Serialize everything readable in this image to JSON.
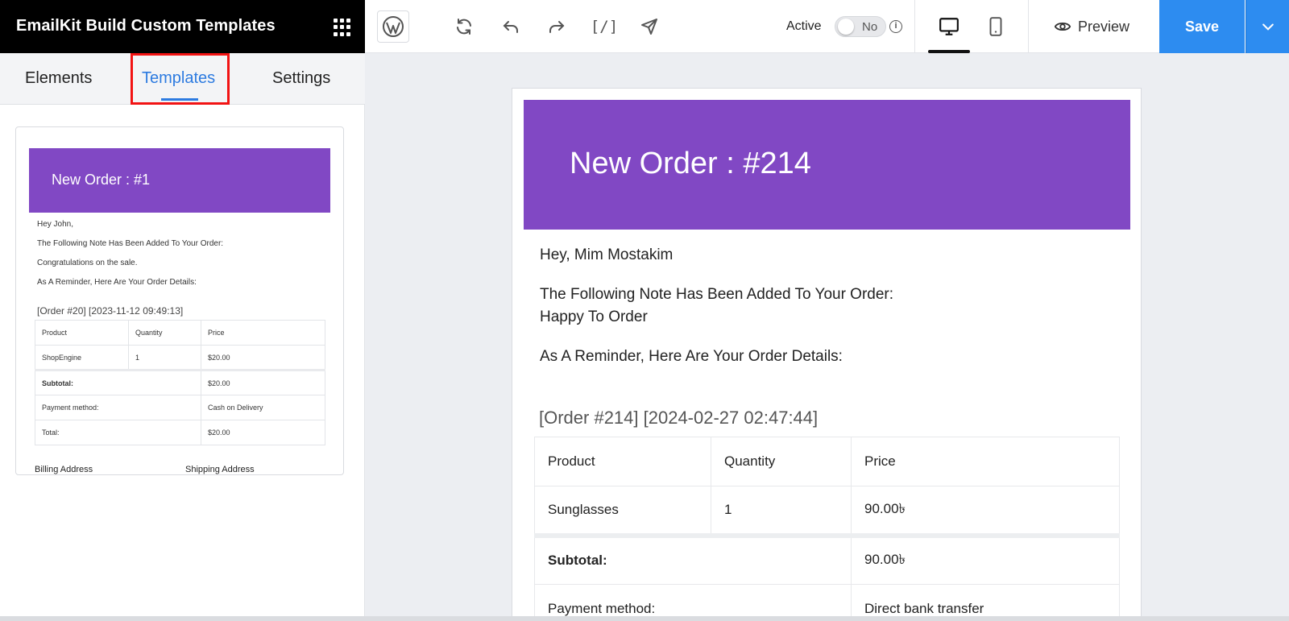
{
  "app": {
    "title": "EmailKit Build Custom Templates"
  },
  "toolbar": {
    "code_label": "[/]",
    "active_label": "Active",
    "toggle_value": "No",
    "info_label": "i",
    "preview_label": "Preview",
    "save_label": "Save"
  },
  "sidebar": {
    "tabs": [
      {
        "label": "Elements"
      },
      {
        "label": "Templates"
      },
      {
        "label": "Settings"
      }
    ],
    "active_tab": "Templates",
    "template_card": {
      "title": "New Order : #1",
      "greeting": "Hey John,",
      "note_intro": "The Following Note Has Been Added To Your Order:",
      "note": "Congratulations on the sale.",
      "reminder": "As A Reminder, Here Are Your Order Details:",
      "order_line": "[Order #20] [2023-11-12 09:49:13]",
      "table": {
        "headers": [
          "Product",
          "Quantity",
          "Price"
        ],
        "row": [
          "ShopEngine",
          "1",
          "$20.00"
        ],
        "subtotal_label": "Subtotal:",
        "subtotal_value": "$20.00",
        "payment_label": "Payment method:",
        "payment_value": "Cash on Delivery",
        "total_label": "Total:",
        "total_value": "$20.00"
      },
      "billing_label": "Billing Address",
      "shipping_label": "Shipping Address"
    }
  },
  "email": {
    "title": "New Order : #214",
    "greeting": "Hey, Mim Mostakim",
    "note_intro": "The Following Note Has Been Added To Your Order:",
    "note": "Happy To Order",
    "reminder": "As A Reminder, Here Are Your Order Details:",
    "order_line": "[Order #214] [2024-02-27 02:47:44]",
    "table": {
      "headers": [
        "Product",
        "Quantity",
        "Price"
      ],
      "row": [
        "Sunglasses",
        "1",
        "90.00৳"
      ],
      "subtotal_label": "Subtotal:",
      "subtotal_value": "90.00৳",
      "payment_label": "Payment method:",
      "payment_value": "Direct bank transfer"
    }
  },
  "colors": {
    "brand_bar": "#000000",
    "accent": "#2d8cf0",
    "email_header": "#8148c4",
    "tab_highlight": "#f21313"
  },
  "icons": [
    "grid-icon",
    "wordpress-icon",
    "refresh-icon",
    "undo-icon",
    "redo-icon",
    "send-icon",
    "info-icon",
    "desktop-icon",
    "mobile-icon",
    "eye-icon",
    "chevron-down-icon"
  ]
}
